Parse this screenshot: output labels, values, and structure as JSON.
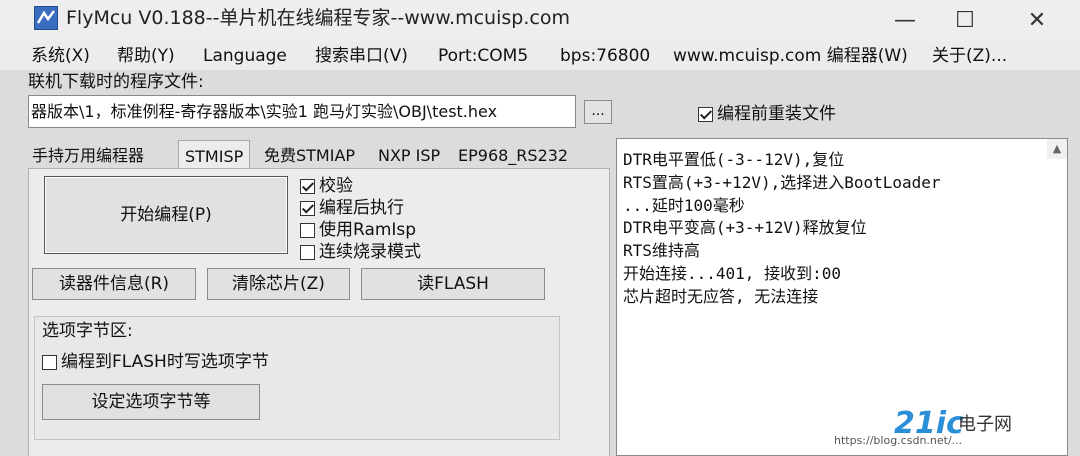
{
  "window": {
    "title": "FlyMcu V0.188--单片机在线编程专家--www.mcuisp.com",
    "controls": {
      "minimize": "—",
      "maximize": "☐",
      "close": "✕"
    }
  },
  "menu": [
    "系统(X)",
    "帮助(Y)",
    "Language",
    "搜索串口(V)",
    "Port:COM5",
    "bps:76800",
    "www.mcuisp.com 编程器(W)",
    "关于(Z)..."
  ],
  "file": {
    "label": "联机下载时的程序文件:",
    "path": "器版本\\1，标准例程-寄存器版本\\实验1 跑马灯实验\\OBJ\\test.hex",
    "browse_label": "...",
    "reload_label": "编程前重装文件",
    "reload_checked": true
  },
  "tabs": [
    {
      "label": "手持万用编程器",
      "active": false
    },
    {
      "label": "STMISP",
      "active": true
    },
    {
      "label": "免费STMIAP",
      "active": false
    },
    {
      "label": "NXP ISP",
      "active": false
    },
    {
      "label": "EP968_RS232",
      "active": false
    }
  ],
  "actions": {
    "start_program": "开始编程(P)",
    "read_info": "读器件信息(R)",
    "erase_chip": "清除芯片(Z)",
    "read_flash": "读FLASH"
  },
  "options": [
    {
      "label": "校验",
      "checked": true
    },
    {
      "label": "编程后执行",
      "checked": true
    },
    {
      "label": "使用RamIsp",
      "checked": false
    },
    {
      "label": "连续烧录模式",
      "checked": false
    }
  ],
  "option_bytes": {
    "title": "选项字节区:",
    "write_label": "编程到FLASH时写选项字节",
    "write_checked": false,
    "set_button": "设定选项字节等"
  },
  "log": [
    "DTR电平置低(-3--12V),复位",
    "RTS置高(+3-+12V),选择进入BootLoader",
    "...延时100毫秒",
    "DTR电平变高(+3-+12V)释放复位",
    "RTS维持高",
    "开始连接...401, 接收到:00",
    "芯片超时无应答, 无法连接"
  ],
  "watermark": {
    "brand": "21ic",
    "name": "电子网",
    "url": "https://blog.csdn.net/...",
    "color": "#2a8fd6"
  }
}
